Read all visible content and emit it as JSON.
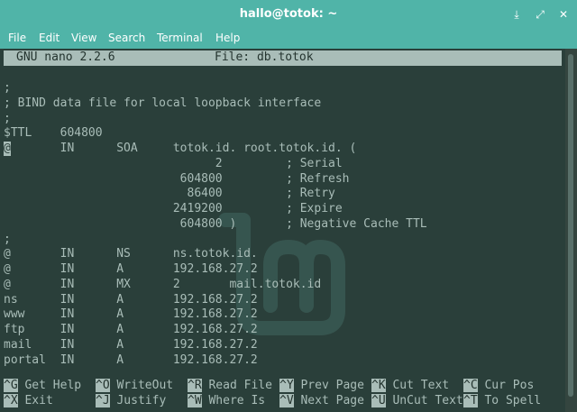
{
  "window": {
    "title": "hallo@totok: ~"
  },
  "menu": [
    "File",
    "Edit",
    "View",
    "Search",
    "Terminal",
    "Help"
  ],
  "nano": {
    "version": "GNU nano 2.2.6",
    "file": "File: db.totok"
  },
  "lines": [
    "",
    ";",
    "; BIND data file for local loopback interface",
    ";",
    "$TTL    604800",
    "@       IN      SOA     totok.id. root.totok.id. (",
    "                              2         ; Serial",
    "                         604800         ; Refresh",
    "                          86400         ; Retry",
    "                        2419200         ; Expire",
    "                         604800 )       ; Negative Cache TTL",
    ";",
    "@       IN      NS      ns.totok.id.",
    "@       IN      A       192.168.27.2",
    "@       IN      MX      2       mail.totok.id",
    "ns      IN      A       192.168.27.2",
    "www     IN      A       192.168.27.2",
    "ftp     IN      A       192.168.27.2",
    "mail    IN      A       192.168.27.2",
    "portal  IN      A       192.168.27.2"
  ],
  "shortcuts": [
    {
      "key": "^G",
      "label": "Get Help"
    },
    {
      "key": "^O",
      "label": "WriteOut"
    },
    {
      "key": "^R",
      "label": "Read File"
    },
    {
      "key": "^Y",
      "label": "Prev Page"
    },
    {
      "key": "^K",
      "label": "Cut Text"
    },
    {
      "key": "^C",
      "label": "Cur Pos"
    },
    {
      "key": "^X",
      "label": "Exit"
    },
    {
      "key": "^J",
      "label": "Justify"
    },
    {
      "key": "^W",
      "label": "Where Is"
    },
    {
      "key": "^V",
      "label": "Next Page"
    },
    {
      "key": "^U",
      "label": "UnCut Text"
    },
    {
      "key": "^T",
      "label": "To Spell"
    }
  ]
}
